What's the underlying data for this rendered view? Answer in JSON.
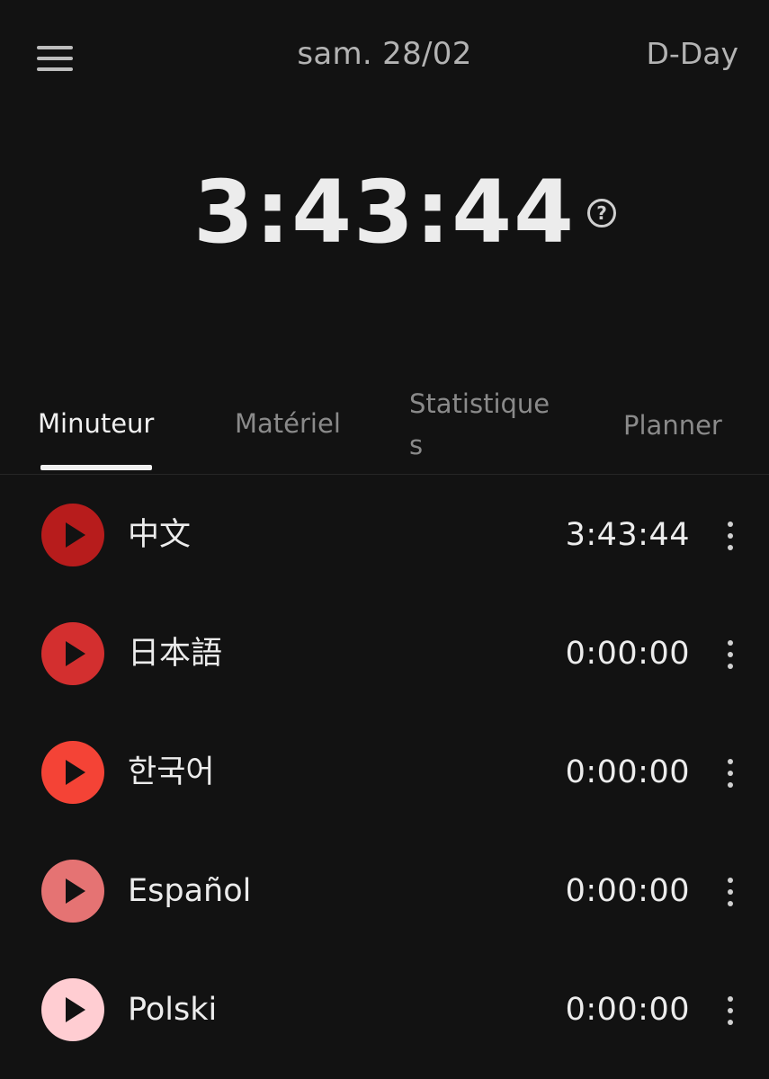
{
  "header": {
    "date": "sam. 28/02",
    "dday_label": "D-Day"
  },
  "main_timer": {
    "value": "3:43:44",
    "help_glyph": "?"
  },
  "tabs": [
    {
      "label": "Minuteur",
      "active": true
    },
    {
      "label": "Matériel",
      "active": false
    },
    {
      "label": "Statistiques",
      "active": false
    },
    {
      "label": "Planner",
      "active": false
    }
  ],
  "timers": [
    {
      "label": "中文",
      "time": "3:43:44",
      "color": "#b71c1c"
    },
    {
      "label": "日本語",
      "time": "0:00:00",
      "color": "#d32f2f"
    },
    {
      "label": "한국어",
      "time": "0:00:00",
      "color": "#f44336"
    },
    {
      "label": "Español",
      "time": "0:00:00",
      "color": "#e57373"
    },
    {
      "label": "Polski",
      "time": "0:00:00",
      "color": "#ffcdd2"
    }
  ]
}
